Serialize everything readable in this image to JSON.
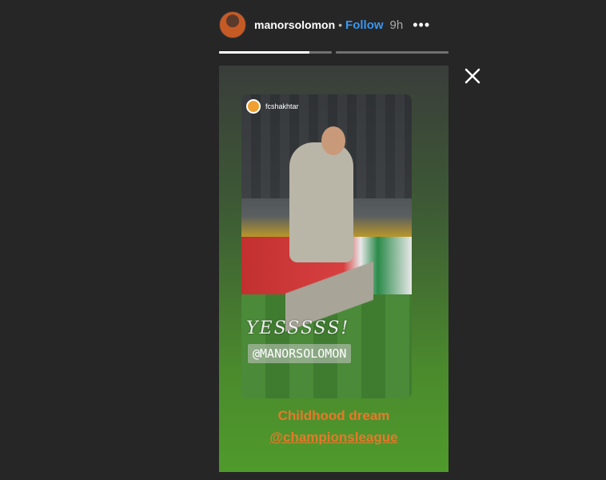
{
  "header": {
    "username": "manorsolomon",
    "dot": "•",
    "follow_label": "Follow",
    "time": "9h",
    "more_glyph": "•••"
  },
  "progress": [
    {
      "fill": 0.8
    },
    {
      "fill": 0
    }
  ],
  "close": {
    "glyph": "×"
  },
  "story": {
    "embedded_post": {
      "username": "fcshakhtar",
      "yes_text": "YESSSSS!",
      "mention": "@MANORSOLOMON"
    },
    "caption_line1": "Childhood dream",
    "caption_line2": "@championsleague"
  },
  "colors": {
    "background": "#262626",
    "follow": "#3897f0",
    "caption": "#e8782a"
  }
}
